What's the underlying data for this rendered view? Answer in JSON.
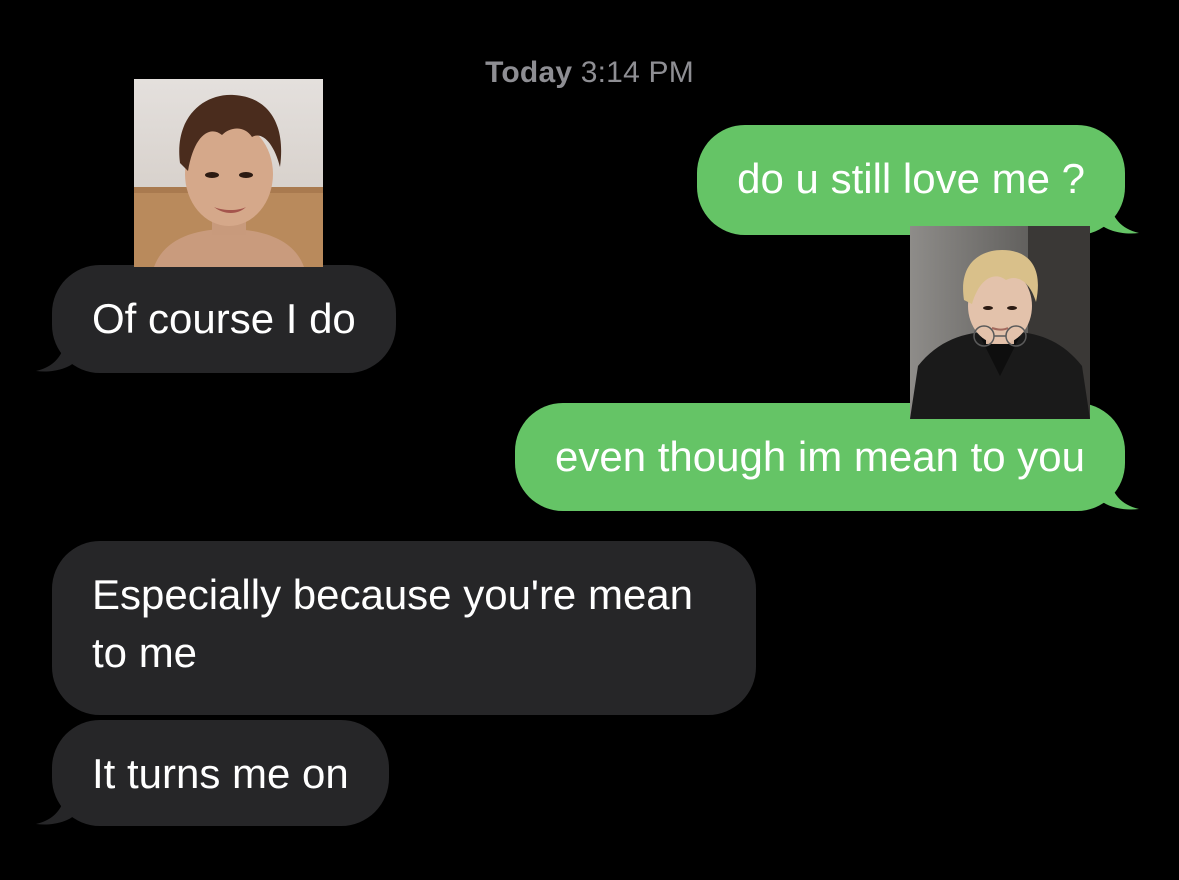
{
  "conversation": {
    "timestamp_day": "Today",
    "timestamp_time": "3:14 PM",
    "messages": [
      {
        "side": "sent",
        "text": "do u still love me ?"
      },
      {
        "side": "received",
        "text": "Of course I do"
      },
      {
        "side": "sent",
        "text": "even though im mean to you"
      },
      {
        "side": "received",
        "text": "Especially because you're mean to me"
      },
      {
        "side": "received",
        "text": "It turns me on"
      }
    ]
  },
  "colors": {
    "background": "#000000",
    "sent_bubble": "#65c466",
    "received_bubble": "#262628",
    "timestamp": "#8e8e93",
    "text": "#ffffff"
  }
}
